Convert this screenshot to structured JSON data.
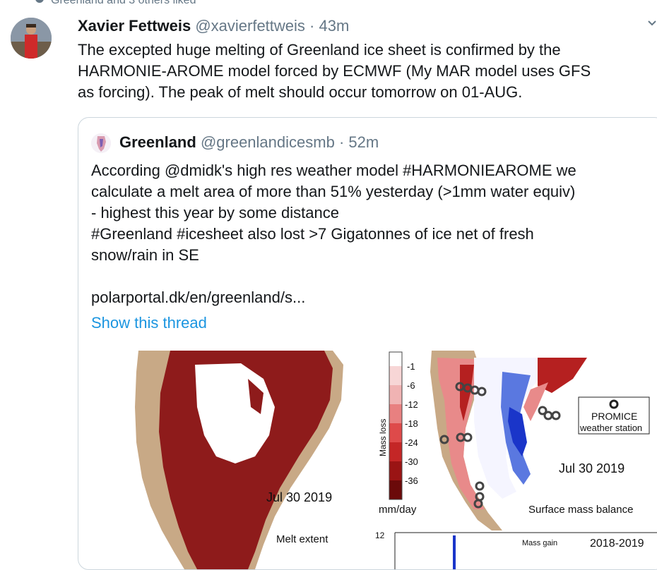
{
  "social_context": {
    "text": "Greenland and 3 others liked"
  },
  "tweet": {
    "name": "Xavier Fettweis",
    "handle": "@xavierfettweis",
    "separator": "·",
    "time": "43m",
    "text_lines": [
      "The excepted huge melting of Greenland ice sheet is confirmed by the",
      "HARMONIE-AROME model forced by ECMWF (My MAR model uses GFS",
      "as forcing). The peak of melt should occur tomorrow on 01-AUG."
    ]
  },
  "quoted_tweet": {
    "name": "Greenland",
    "handle": "@greenlandicesmb",
    "separator": "·",
    "time": "52m",
    "text_lines": [
      "According @dmidk's high res weather model #HARMONIEAROME we",
      "calculate a melt area of more than 51% yesterday (>1mm water equiv)",
      "- highest this year by some distance",
      "#Greenland #icesheet also lost >7 Gigatonnes of ice net of fresh",
      "snow/rain in SE",
      "",
      "polarportal.dk/en/greenland/s..."
    ],
    "show_thread": "Show this thread"
  },
  "media": {
    "melt_map": {
      "date": "Jul 30 2019",
      "caption": "Melt extent"
    },
    "smb_map": {
      "legend_title": "Mass loss",
      "legend_ticks": [
        "-1",
        "-6",
        "-12",
        "-18",
        "-24",
        "-30",
        "-36"
      ],
      "legend_unit": "mm/day",
      "legend_colors": [
        "#ffffff",
        "#f7d6d6",
        "#f0b3b3",
        "#e88080",
        "#de4a4a",
        "#c42626",
        "#9a1414",
        "#6b0a0a"
      ],
      "station_label_1": "PROMICE",
      "station_label_2": "weather station",
      "date": "Jul 30 2019",
      "caption": "Surface mass balance"
    },
    "small_chart": {
      "y_tick": "12",
      "legend_label": "Mass gain",
      "year_label": "2018-2019"
    },
    "colors": {
      "melt": "#8e1b1b",
      "land": "#c8a986",
      "blue": "#1a35c9"
    }
  }
}
